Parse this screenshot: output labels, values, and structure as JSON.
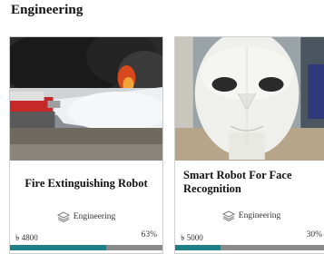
{
  "section": {
    "title": "Engineering"
  },
  "cards": [
    {
      "title": "Fire Extinguishing Robot",
      "category": "Engineering",
      "price": "৳ 4800",
      "percent": "63%",
      "progress": 0.63,
      "image": "fire-extinguishing-robot-photo",
      "progress_color": "#1f7f86",
      "track_color": "#8a8a8a"
    },
    {
      "title": "Smart Robot For Face Recognition",
      "category": "Engineering",
      "price": "৳ 5000",
      "percent": "30%",
      "progress": 0.3,
      "image": "robot-face-photo",
      "progress_color": "#1f7f86",
      "track_color": "#8a8a8a"
    }
  ]
}
